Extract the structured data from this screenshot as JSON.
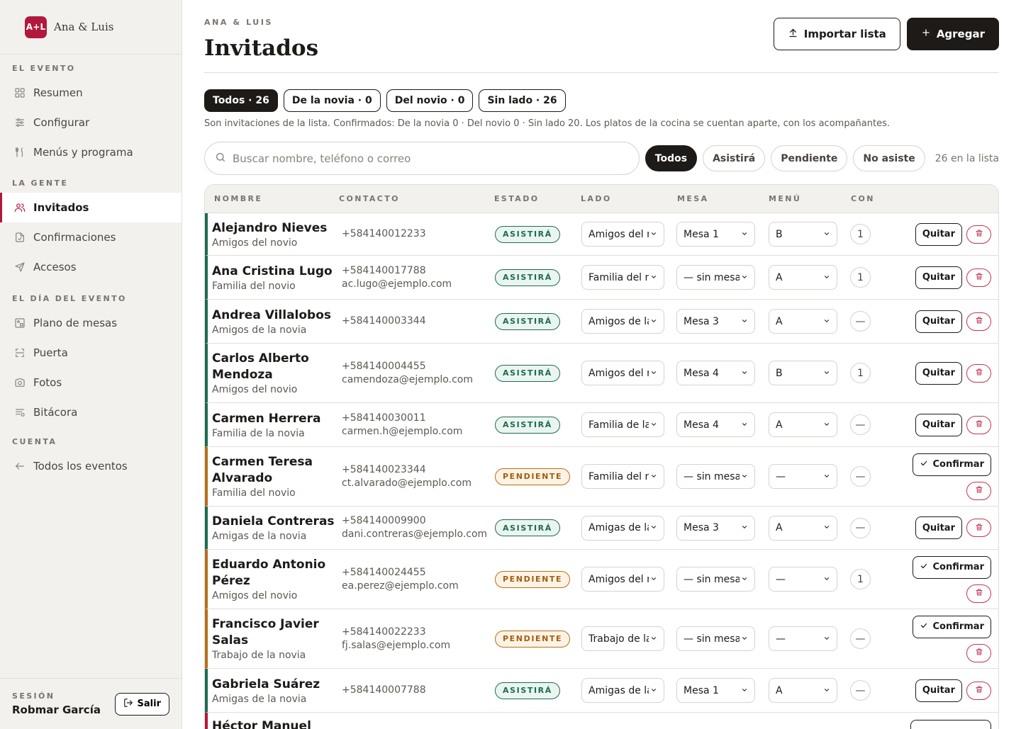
{
  "brand": {
    "logo": "A+L",
    "name": "Ana & Luis"
  },
  "sidebar": {
    "sections": [
      {
        "label": "El evento",
        "items": [
          {
            "label": "Resumen",
            "icon": "grid-icon"
          },
          {
            "label": "Configurar",
            "icon": "sliders-icon"
          },
          {
            "label": "Menús y programa",
            "icon": "utensils-icon"
          }
        ]
      },
      {
        "label": "La gente",
        "items": [
          {
            "label": "Invitados",
            "icon": "users-icon",
            "active": true
          },
          {
            "label": "Confirmaciones",
            "icon": "file-check-icon"
          },
          {
            "label": "Accesos",
            "icon": "send-icon"
          }
        ]
      },
      {
        "label": "El día del evento",
        "items": [
          {
            "label": "Plano de mesas",
            "icon": "floor-plan-icon"
          },
          {
            "label": "Puerta",
            "icon": "scan-icon"
          },
          {
            "label": "Fotos",
            "icon": "camera-icon"
          },
          {
            "label": "Bitácora",
            "icon": "log-icon"
          }
        ]
      },
      {
        "label": "Cuenta",
        "items": [
          {
            "label": "Todos los eventos",
            "icon": "arrow-left-icon"
          }
        ]
      }
    ],
    "session": {
      "label": "SESIÓN",
      "user": "Robmar García",
      "logout": "Salir"
    }
  },
  "header": {
    "eyebrow": "ANA & LUIS",
    "title": "Invitados",
    "import_label": "Importar lista",
    "add_label": "Agregar"
  },
  "side_tabs": [
    "Todos · 26",
    "De la novia · 0",
    "Del novio · 0",
    "Sin lado · 26"
  ],
  "note": "Son invitaciones de la lista. Confirmados: De la novia 0 · Del novio 0 · Sin lado 20. Los platos de la cocina se cuentan aparte, con los acompañantes.",
  "search": {
    "placeholder": "Buscar nombre, teléfono o correo"
  },
  "status_filters": [
    "Todos",
    "Asistirá",
    "Pendiente",
    "No asiste"
  ],
  "list_count": "26 en la lista",
  "table": {
    "columns": [
      "NOMBRE",
      "CONTACTO",
      "ESTADO",
      "LADO",
      "MESA",
      "MENÚ",
      "CON"
    ],
    "actions": {
      "remove": "Quitar",
      "confirm": "Confirmar"
    },
    "rows": [
      {
        "name": "Alejandro Nieves",
        "group": "Amigos del novio",
        "phone": "+584140012233",
        "email": "",
        "status": "ASISTIRÁ",
        "side": "Amigos del novio",
        "table": "Mesa 1",
        "menu": "B",
        "plus": "1"
      },
      {
        "name": "Ana Cristina Lugo",
        "group": "Familia del novio",
        "phone": "+584140017788",
        "email": "ac.lugo@ejemplo.com",
        "status": "ASISTIRÁ",
        "side": "Familia del novio",
        "table": "— sin mesa —",
        "menu": "A",
        "plus": "1"
      },
      {
        "name": "Andrea Villalobos",
        "group": "Amigos de la novia",
        "phone": "+584140003344",
        "email": "",
        "status": "ASISTIRÁ",
        "side": "Amigos de la novia",
        "table": "Mesa 3",
        "menu": "A",
        "plus": "—"
      },
      {
        "name": "Carlos Alberto Mendoza",
        "group": "Amigos del novio",
        "phone": "+584140004455",
        "email": "camendoza@ejemplo.com",
        "status": "ASISTIRÁ",
        "side": "Amigos del novio",
        "table": "Mesa 4",
        "menu": "B",
        "plus": "1"
      },
      {
        "name": "Carmen Herrera",
        "group": "Familia de la novia",
        "phone": "+584140030011",
        "email": "carmen.h@ejemplo.com",
        "status": "ASISTIRÁ",
        "side": "Familia de la novia",
        "table": "Mesa 4",
        "menu": "A",
        "plus": "—"
      },
      {
        "name": "Carmen Teresa Alvarado",
        "group": "Familia del novio",
        "phone": "+584140023344",
        "email": "ct.alvarado@ejemplo.com",
        "status": "PENDIENTE",
        "side": "Familia del novio",
        "table": "— sin mesa —",
        "menu": "—",
        "plus": "—"
      },
      {
        "name": "Daniela Contreras",
        "group": "Amigas de la novia",
        "phone": "+584140009900",
        "email": "dani.contreras@ejemplo.com",
        "status": "ASISTIRÁ",
        "side": "Amigas de la novia",
        "table": "Mesa 3",
        "menu": "A",
        "plus": "—"
      },
      {
        "name": "Eduardo Antonio Pérez",
        "group": "Amigos del novio",
        "phone": "+584140024455",
        "email": "ea.perez@ejemplo.com",
        "status": "PENDIENTE",
        "side": "Amigos del novio",
        "table": "— sin mesa —",
        "menu": "—",
        "plus": "1"
      },
      {
        "name": "Francisco Javier Salas",
        "group": "Trabajo de la novia",
        "phone": "+584140022233",
        "email": "fj.salas@ejemplo.com",
        "status": "PENDIENTE",
        "side": "Trabajo de la novia",
        "table": "— sin mesa —",
        "menu": "—",
        "plus": "—"
      },
      {
        "name": "Gabriela Suárez",
        "group": "Amigas de la novia",
        "phone": "+584140007788",
        "email": "",
        "status": "ASISTIRÁ",
        "side": "Amigas de la novia",
        "table": "Mesa 1",
        "menu": "A",
        "plus": "—"
      },
      {
        "name": "Héctor Manuel",
        "group": "",
        "phone": "",
        "email": "",
        "status": "",
        "side": "",
        "table": "",
        "menu": "",
        "plus": ""
      }
    ]
  },
  "colors": {
    "accent": "#b3183c",
    "ok": "#1d6b52",
    "pending": "#b76e1a",
    "dark": "#1d1a17"
  }
}
